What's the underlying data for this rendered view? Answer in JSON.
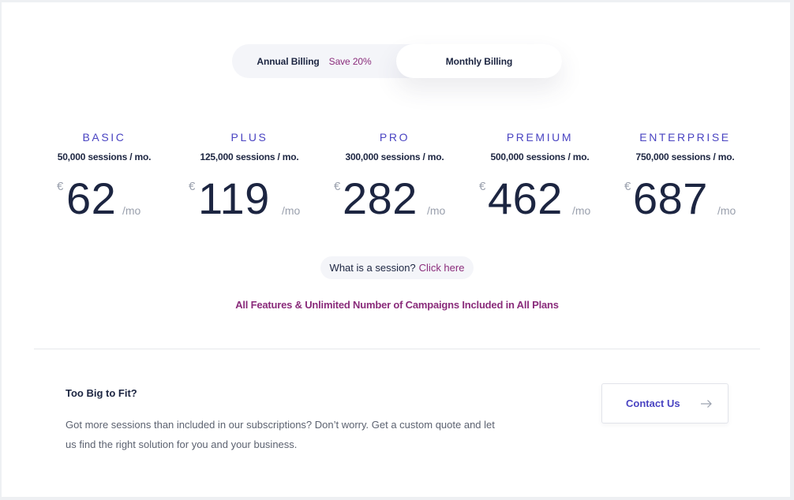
{
  "billing": {
    "annual_label": "Annual Billing",
    "annual_save": "Save 20%",
    "monthly_label": "Monthly Billing",
    "selected": "Monthly Billing"
  },
  "currency_symbol": "€",
  "per_label": "/mo",
  "plans": [
    {
      "name": "BASIC",
      "sessions": "50,000 sessions / mo.",
      "price": "62"
    },
    {
      "name": "PLUS",
      "sessions": "125,000 sessions / mo.",
      "price": "119"
    },
    {
      "name": "PRO",
      "sessions": "300,000 sessions / mo.",
      "price": "282"
    },
    {
      "name": "PREMIUM",
      "sessions": "500,000 sessions / mo.",
      "price": "462"
    },
    {
      "name": "ENTERPRISE",
      "sessions": "750,000 sessions / mo.",
      "price": "687"
    }
  ],
  "session_info": {
    "question": "What is a session?",
    "link": "Click here"
  },
  "features_note": "All Features & Unlimited Number of Campaigns Included in All Plans",
  "custom": {
    "title": "Too Big to Fit?",
    "text": "Got more sessions than included in our subscriptions? Don’t worry. Get a custom quote and let us find the right solution for you and your business.",
    "button_label": "Contact Us"
  },
  "icons": {
    "contact_arrow": "arrow-right-icon"
  },
  "colors": {
    "accent": "#4a44c2",
    "highlight": "#8a2c7b",
    "text": "#1c2541",
    "muted": "#9aa0ad"
  }
}
